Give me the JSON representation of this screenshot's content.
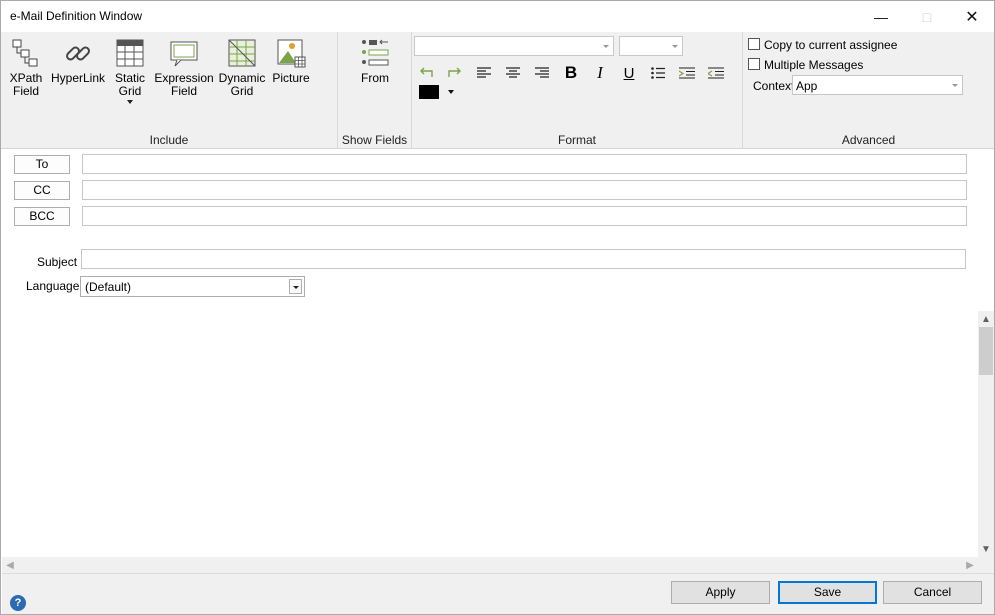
{
  "window": {
    "title": "e-Mail Definition Window"
  },
  "ribbon": {
    "include": {
      "label": "Include",
      "buttons": {
        "xpath_field": "XPath\nField",
        "hyperlink": "HyperLink",
        "static_grid": "Static\nGrid",
        "expression_field": "Expression\nField",
        "dynamic_grid": "Dynamic\nGrid",
        "picture": "Picture"
      }
    },
    "show_fields": {
      "label": "Show Fields",
      "from": "From"
    },
    "format": {
      "label": "Format",
      "font_name": "",
      "font_size": "",
      "text_color": "#000000"
    },
    "advanced": {
      "label": "Advanced",
      "copy_to_assignee": "Copy to current assignee",
      "multiple_messages": "Multiple Messages",
      "context_label": "Context",
      "context_value": "App"
    }
  },
  "form": {
    "to": "To",
    "cc": "CC",
    "bcc": "BCC",
    "subject_label": "Subject",
    "language_label": "Language:",
    "language_value": "(Default)",
    "to_value": "",
    "cc_value": "",
    "bcc_value": "",
    "subject_value": ""
  },
  "footer": {
    "apply": "Apply",
    "save": "Save",
    "cancel": "Cancel",
    "help": "?"
  },
  "colors": {
    "accent": "#0078d7",
    "icon_green": "#7aa34a"
  }
}
